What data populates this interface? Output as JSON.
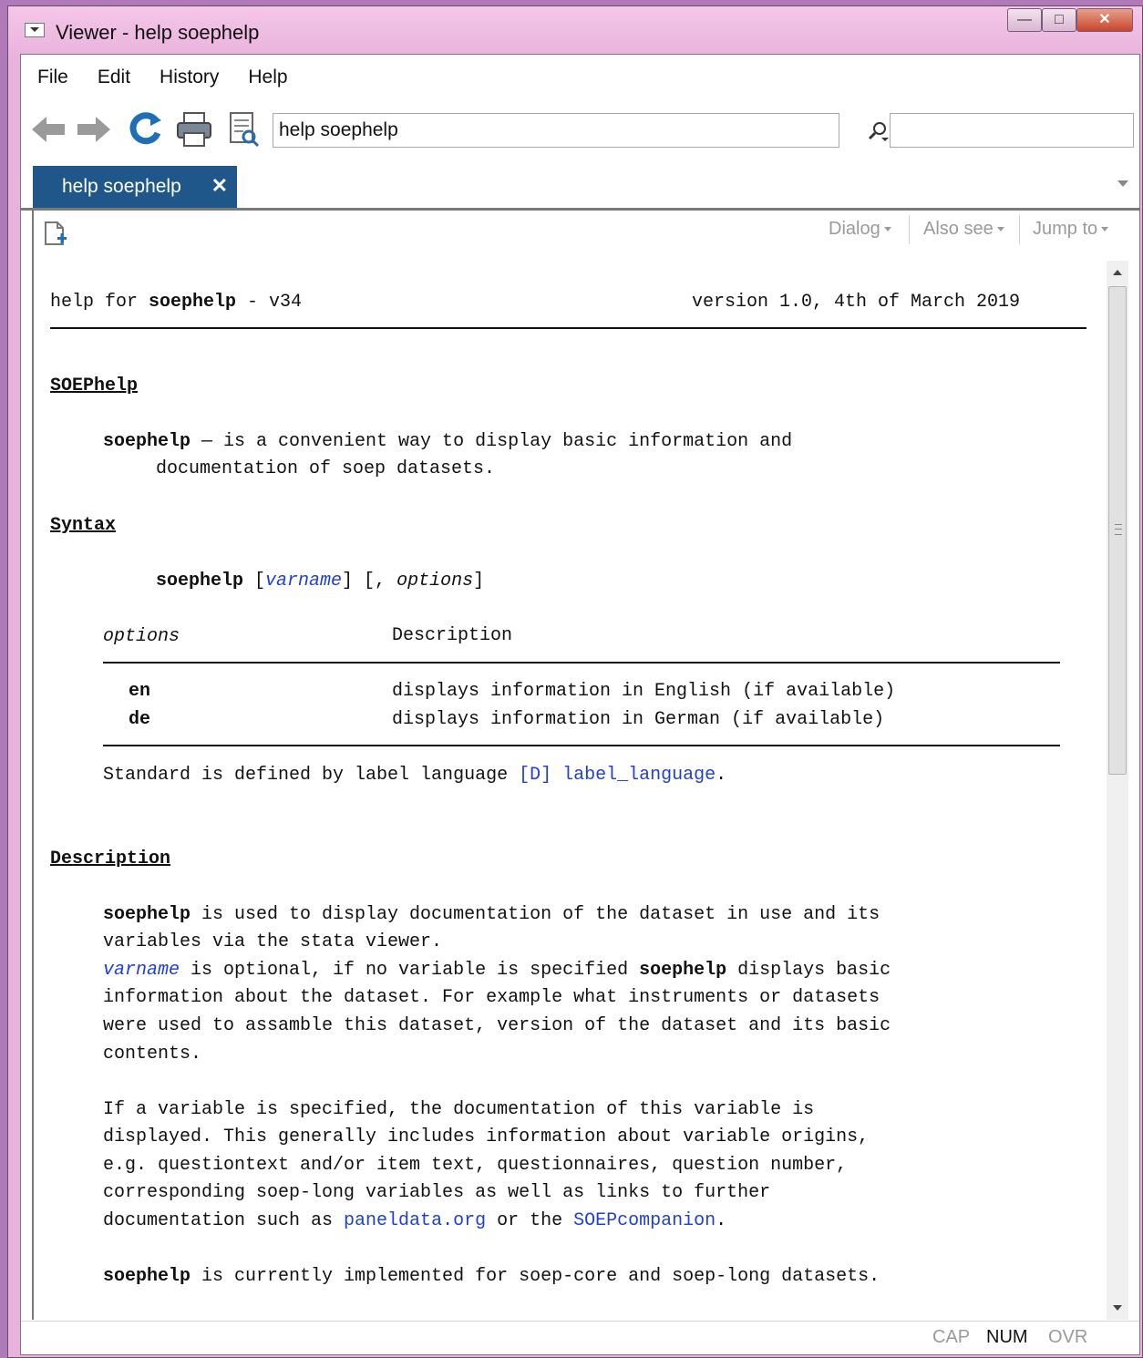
{
  "window": {
    "title": "Viewer - help soephelp"
  },
  "menu": [
    "File",
    "Edit",
    "History",
    "Help"
  ],
  "toolbar": {
    "command_value": "help soephelp",
    "search_value": ""
  },
  "tab": {
    "label": "help soephelp",
    "close": "✕"
  },
  "viewer_toolbar": {
    "dialog": "Dialog",
    "also_see": "Also see",
    "jump_to": "Jump to"
  },
  "doc": {
    "header_left_pre": "help for ",
    "header_left_cmd": "soephelp",
    "header_left_post": " - v34",
    "header_right": "version 1.0, 4th of March 2019",
    "title_heading": "SOEPhelp",
    "title_cmd": "soephelp",
    "title_rest_1": " — is a convenient way to display basic information and",
    "title_rest_2": "documentation of soep datasets.",
    "syntax_heading": "Syntax",
    "syntax_cmd": "soephelp",
    "syntax_open": " [",
    "syntax_varname": "varname",
    "syntax_mid": "] [, ",
    "syntax_options": "options",
    "syntax_close": "]",
    "options_col1": "options",
    "options_col2": "Description",
    "opt_en": "en",
    "opt_en_desc": "displays information in English (if available)",
    "opt_de": "de",
    "opt_de_desc": "displays information in German (if available)",
    "standard_text": "Standard is defined by label language ",
    "standard_link_1": "[D]",
    "standard_link_2": "label_language",
    "standard_end": ".",
    "description_heading": "Description",
    "d1_cmd": "soephelp",
    "d1_rest": " is used to display documentation of the dataset in use and its",
    "d2": "variables via the stata viewer.",
    "d3_link": "varname",
    "d3_mid": " is optional, if no variable is specified ",
    "d3_cmd": "soephelp",
    "d3_end": " displays basic",
    "d4": "information about the dataset. For example what instruments or datasets",
    "d5": "were used to assamble this dataset, version of the dataset and its basic",
    "d6": "contents.",
    "p2_1": "If a variable is specified, the documentation of this variable is",
    "p2_2": "displayed. This generally includes information about variable origins,",
    "p2_3": "e.g. questiontext and/or item text, questionnaires, question number,",
    "p2_4": "corresponding soep-long variables as well as links to further",
    "p2_5_pre": "documentation such as ",
    "p2_5_link1": "paneldata.org",
    "p2_5_mid": " or the ",
    "p2_5_link2": "SOEPcompanion",
    "p2_5_end": ".",
    "p3_cmd": "soephelp",
    "p3_rest": " is currently implemented for soep-core and soep-long datasets."
  },
  "status": {
    "cap": "CAP",
    "num": "NUM",
    "ovr": "OVR"
  }
}
